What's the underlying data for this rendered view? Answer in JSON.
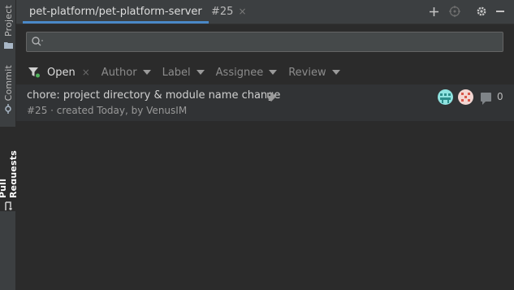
{
  "sidebar": {
    "tabs": [
      {
        "label": "Project"
      },
      {
        "label": "Commit"
      },
      {
        "label": "Pull Requests"
      }
    ]
  },
  "tabbar": {
    "tabs": [
      {
        "label": "pet-platform/pet-platform-server"
      },
      {
        "label": "#25",
        "close": "×"
      }
    ],
    "icons": [
      "plus-icon",
      "target-icon",
      "gear-icon",
      "minimize-icon"
    ]
  },
  "search": {
    "icon": "search-icon",
    "placeholder": "",
    "value": ""
  },
  "filters": {
    "icon": "filter-icon",
    "chips": [
      {
        "label": "Open",
        "clear": "×"
      },
      {
        "label": "Author"
      },
      {
        "label": "Label"
      },
      {
        "label": "Assignee"
      },
      {
        "label": "Review"
      }
    ]
  },
  "pull_requests": [
    {
      "title": "chore: project directory & module name change",
      "meta": "#25 · created Today, by VenusIM",
      "comments": "0",
      "icons": [
        "tag-icon",
        "comment-icon"
      ]
    }
  ],
  "colors": {
    "accent": "#4a88c7",
    "background": "#2b2b2b",
    "panel": "#3c3f41"
  }
}
